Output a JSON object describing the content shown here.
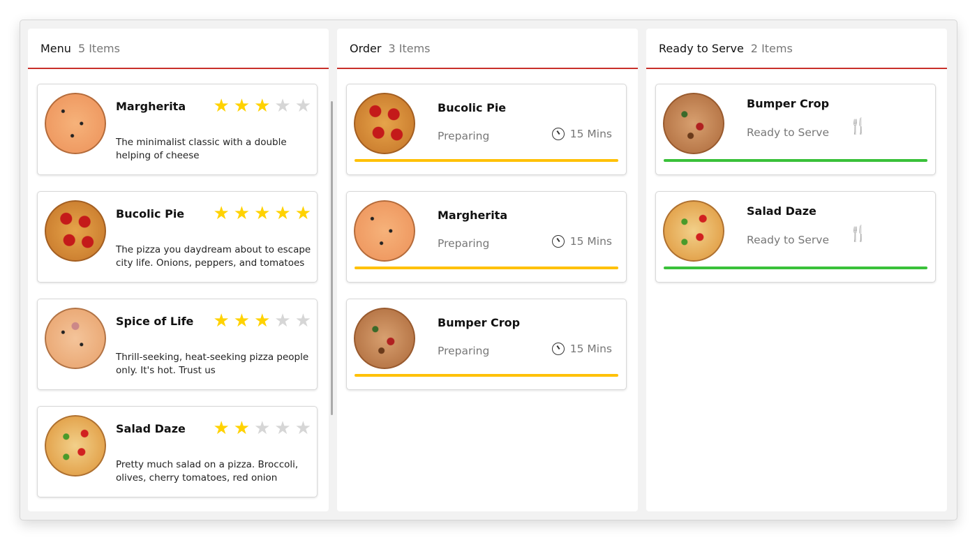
{
  "menu": {
    "title": "Menu",
    "count": "5 Items",
    "items": [
      {
        "name": "Margherita",
        "rating": 3,
        "description": "The minimalist classic with a double helping of cheese"
      },
      {
        "name": "Bucolic Pie",
        "rating": 5,
        "description": "The pizza you daydream about to escape city life. Onions, peppers, and tomatoes"
      },
      {
        "name": "Spice of Life",
        "rating": 3,
        "description": "Thrill-seeking, heat-seeking pizza people only.  It's hot. Trust us"
      },
      {
        "name": "Salad Daze",
        "rating": 2,
        "description": "Pretty much salad on a pizza. Broccoli, olives, cherry tomatoes, red onion"
      }
    ]
  },
  "order": {
    "title": "Order",
    "count": "3 Items",
    "items": [
      {
        "name": "Bucolic Pie",
        "status": "Preparing",
        "time": "15 Mins"
      },
      {
        "name": "Margherita",
        "status": "Preparing",
        "time": "15 Mins"
      },
      {
        "name": "Bumper Crop",
        "status": "Preparing",
        "time": "15 Mins"
      }
    ]
  },
  "ready": {
    "title": "Ready to Serve",
    "count": "2 Items",
    "items": [
      {
        "name": "Bumper Crop",
        "status": "Ready to Serve"
      },
      {
        "name": "Salad Daze",
        "status": "Ready to Serve"
      }
    ]
  },
  "colors": {
    "accent": "#c8302a",
    "preparing": "#ffc107",
    "ready": "#3ac13a",
    "star_on": "#ffd200",
    "star_off": "#d6d6d6"
  }
}
